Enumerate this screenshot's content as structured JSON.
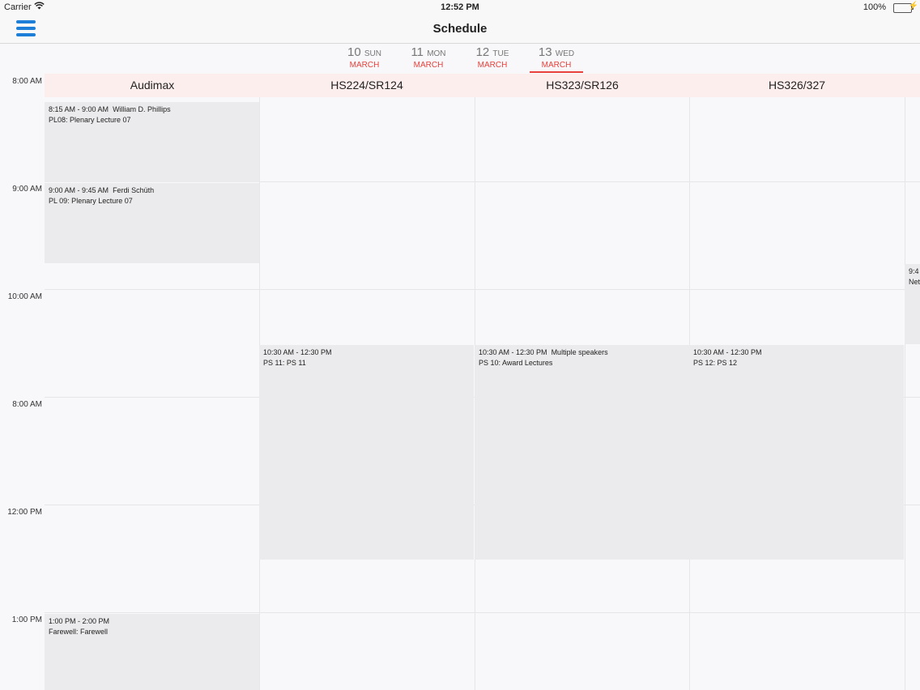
{
  "status_bar": {
    "carrier": "Carrier",
    "time": "12:52 PM",
    "battery": "100%"
  },
  "nav": {
    "title": "Schedule"
  },
  "days": [
    {
      "num": "10",
      "weekday": "SUN",
      "month": "MARCH",
      "active": false
    },
    {
      "num": "11",
      "weekday": "MON",
      "month": "MARCH",
      "active": false
    },
    {
      "num": "12",
      "weekday": "TUE",
      "month": "MARCH",
      "active": false
    },
    {
      "num": "13",
      "weekday": "WED",
      "month": "MARCH",
      "active": true
    }
  ],
  "time_labels": [
    "8:00 AM",
    "9:00 AM",
    "10:00 AM",
    "8:00 AM",
    "12:00 PM",
    "1:00 PM"
  ],
  "rooms": [
    "Audimax",
    "HS224/SR124",
    "HS323/SR126",
    "HS326/327",
    ""
  ],
  "events": [
    {
      "room": 0,
      "start_hour": 8.25,
      "end_hour": 9.0,
      "time": "8:15 AM - 9:00 AM",
      "speaker": "William D. Phillips",
      "title": "PL08: Plenary Lecture 07"
    },
    {
      "room": 0,
      "start_hour": 9.0,
      "end_hour": 9.75,
      "time": "9:00 AM - 9:45 AM",
      "speaker": "Ferdi Schüth",
      "title": "PL 09: Plenary Lecture 07"
    },
    {
      "room": 1,
      "start_hour": 10.5,
      "end_hour": 12.5,
      "time": "10:30 AM - 12:30 PM",
      "speaker": "",
      "title": "PS 11: PS 11"
    },
    {
      "room": 2,
      "start_hour": 10.5,
      "end_hour": 12.5,
      "time": "10:30 AM - 12:30 PM",
      "speaker": "Multiple speakers",
      "title": "PS 10: Award Lectures"
    },
    {
      "room": 3,
      "start_hour": 10.5,
      "end_hour": 12.5,
      "time": "10:30 AM - 12:30 PM",
      "speaker": "",
      "title": "PS 12: PS 12"
    },
    {
      "room": 4,
      "start_hour": 9.75,
      "end_hour": 10.5,
      "time": "9:4",
      "speaker": "",
      "title": "Net"
    },
    {
      "room": 0,
      "start_hour": 13.0,
      "end_hour": 14.0,
      "time": "1:00 PM - 2:00 PM",
      "speaker": "",
      "title": "Farewell: Farewell"
    }
  ]
}
